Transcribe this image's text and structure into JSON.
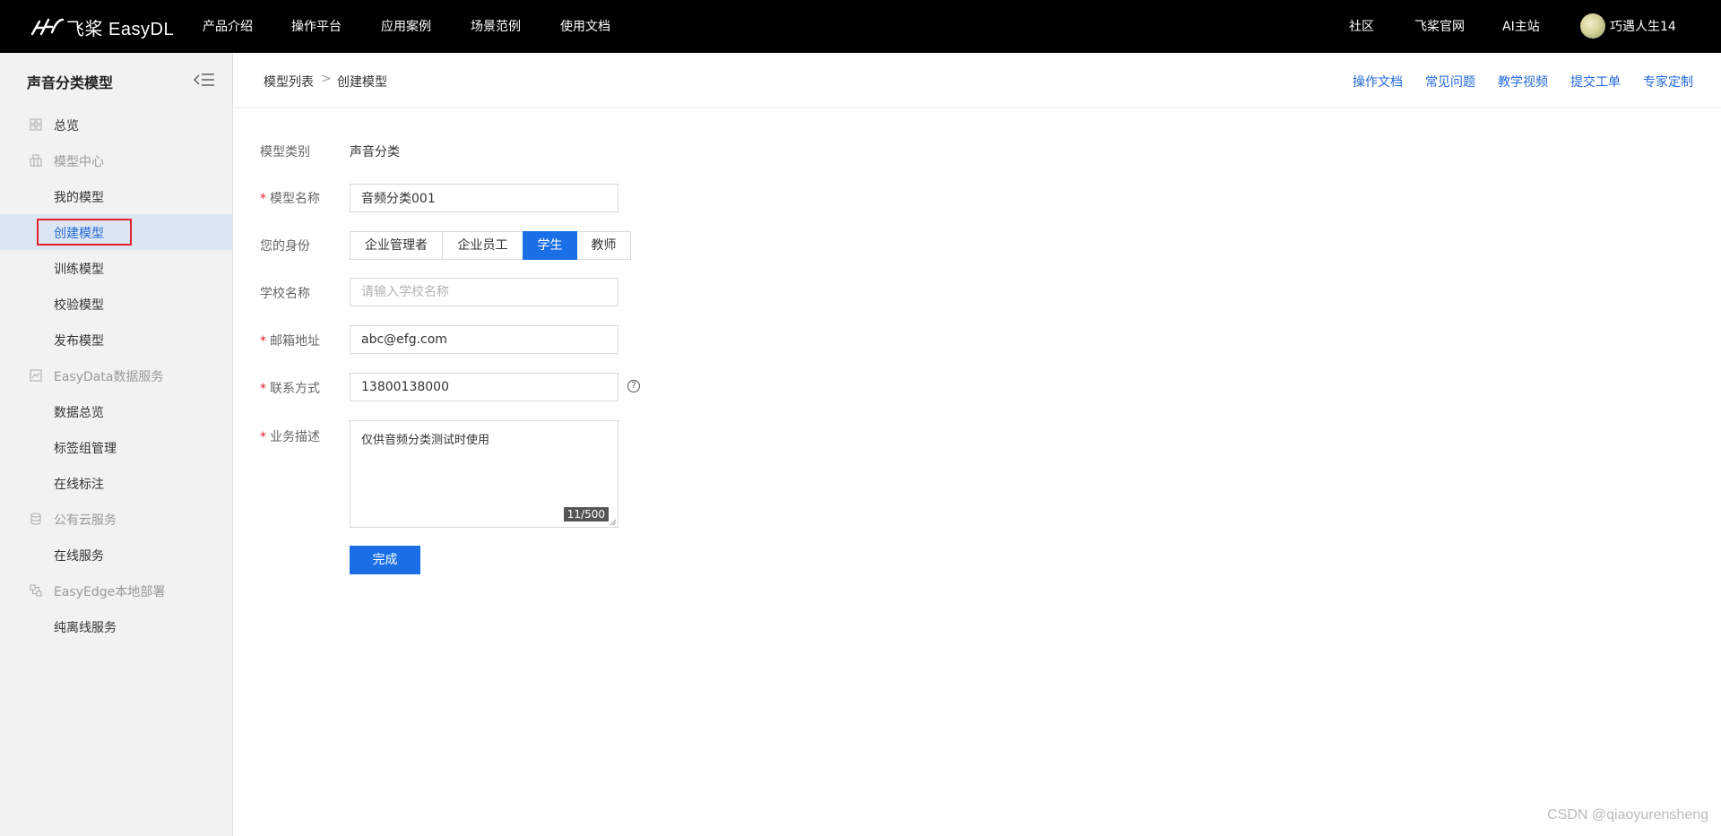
{
  "topbar": {
    "logo_text": "飞桨 EasyDL",
    "nav": [
      "产品介绍",
      "操作平台",
      "应用案例",
      "场景范例",
      "使用文档"
    ],
    "right_links": [
      "社区",
      "飞桨官网",
      "AI主站"
    ],
    "username": "巧遇人生14"
  },
  "sidebar": {
    "title": "声音分类模型",
    "items": [
      {
        "type": "top",
        "label": "总览",
        "icon": "grid-icon"
      },
      {
        "type": "group",
        "label": "模型中心",
        "icon": "building-icon"
      },
      {
        "type": "item",
        "label": "我的模型"
      },
      {
        "type": "item",
        "label": "创建模型",
        "active": true
      },
      {
        "type": "item",
        "label": "训练模型"
      },
      {
        "type": "item",
        "label": "校验模型"
      },
      {
        "type": "item",
        "label": "发布模型"
      },
      {
        "type": "group",
        "label": "EasyData数据服务",
        "icon": "chart-icon"
      },
      {
        "type": "item",
        "label": "数据总览"
      },
      {
        "type": "item",
        "label": "标签组管理"
      },
      {
        "type": "item",
        "label": "在线标注"
      },
      {
        "type": "group",
        "label": "公有云服务",
        "icon": "database-icon"
      },
      {
        "type": "item",
        "label": "在线服务"
      },
      {
        "type": "group",
        "label": "EasyEdge本地部署",
        "icon": "device-icon"
      },
      {
        "type": "item",
        "label": "纯离线服务"
      }
    ]
  },
  "header": {
    "breadcrumb": [
      "模型列表",
      "创建模型"
    ],
    "breadcrumb_sep": ">",
    "help_links": [
      "操作文档",
      "常见问题",
      "教学视频",
      "提交工单",
      "专家定制"
    ]
  },
  "form": {
    "model_type": {
      "label": "模型类别",
      "value": "声音分类"
    },
    "model_name": {
      "label": "模型名称",
      "value": "音频分类001"
    },
    "identity": {
      "label": "您的身份",
      "options": [
        "企业管理者",
        "企业员工",
        "学生",
        "教师"
      ],
      "selected": "学生"
    },
    "school": {
      "label": "学校名称",
      "placeholder": "请输入学校名称"
    },
    "email": {
      "label": "邮箱地址",
      "value": "abc@efg.com"
    },
    "phone": {
      "label": "联系方式",
      "value": "13800138000"
    },
    "description": {
      "label": "业务描述",
      "value": "仅供音频分类测试时使用",
      "counter": "11/500"
    },
    "submit_label": "完成"
  },
  "watermark": "CSDN @qiaoyurensheng",
  "colors": {
    "accent": "#1a6fe6",
    "link": "#2468d8",
    "required": "#e0222b",
    "highlight_box": "#e0222b"
  }
}
